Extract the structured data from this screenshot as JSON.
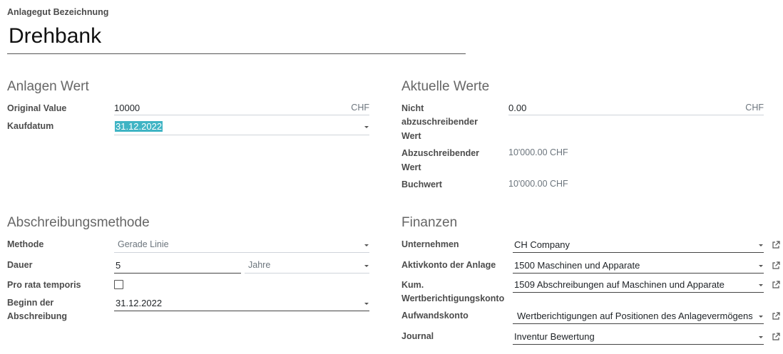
{
  "header": {
    "name_label": "Anlagegut Bezeichnung",
    "name_value": "Drehbank"
  },
  "anlagen_wert": {
    "title": "Anlagen Wert",
    "original_value_label": "Original Value",
    "original_value": "10000",
    "original_currency": "CHF",
    "kaufdatum_label": "Kaufdatum",
    "kaufdatum": "31.12.2022"
  },
  "aktuelle_werte": {
    "title": "Aktuelle Werte",
    "nicht_label_1": "Nicht",
    "nicht_label_2": "abzuschreibender",
    "nicht_label_3": "Wert",
    "nicht_value": "0.00",
    "nicht_currency": "CHF",
    "abzu_label_1": "Abzuschreibender",
    "abzu_label_2": "Wert",
    "abzu_value": "10'000.00 CHF",
    "buchwert_label": "Buchwert",
    "buchwert_value": "10'000.00 CHF"
  },
  "abschreibung": {
    "title": "Abschreibungsmethode",
    "methode_label": "Methode",
    "methode_value": "Gerade Linie",
    "dauer_label": "Dauer",
    "dauer_value": "5",
    "dauer_unit": "Jahre",
    "prorata_label": "Pro rata temporis",
    "prorata_checked": false,
    "beginn_label_1": "Beginn der",
    "beginn_label_2": "Abschreibung",
    "beginn_value": "31.12.2022"
  },
  "finanzen": {
    "title": "Finanzen",
    "unternehmen_label": "Unternehmen",
    "unternehmen_value": "CH Company",
    "aktivkonto_label": "Aktivkonto der Anlage",
    "aktivkonto_value": "1500 Maschinen und Apparate",
    "kum_label_1": "Kum.",
    "kum_label_2": "Wertberichtigungskonto",
    "kum_value": "1509 Abschreibungen auf Maschinen und Apparate",
    "aufwand_label": "Aufwandskonto",
    "aufwand_value": "Wertberichtigungen auf Positionen des Anlagevermögens",
    "journal_label": "Journal",
    "journal_value": "Inventur Bewertung"
  },
  "icons": {
    "external_link": "external-link-icon",
    "dropdown": "caret-down-icon"
  },
  "colors": {
    "selection": "#3fb4c4"
  }
}
